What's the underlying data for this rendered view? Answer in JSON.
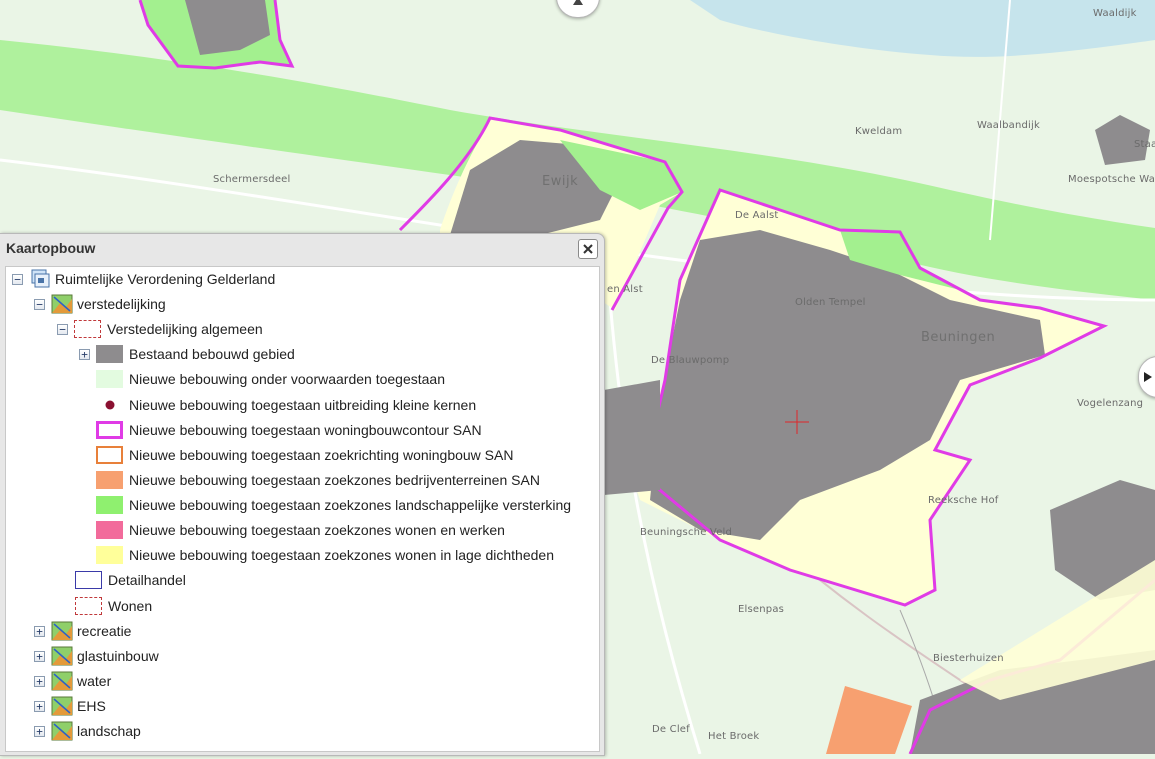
{
  "map": {
    "place_labels": [
      {
        "text": "Waaldijk"
      },
      {
        "text": "Kweldam"
      },
      {
        "text": "Waalbandijk"
      },
      {
        "text": "Schermersdeel"
      },
      {
        "text": "Ewijk"
      },
      {
        "text": "Moespotsche Waa"
      },
      {
        "text": "De Aalst"
      },
      {
        "text": "Olden Tempel"
      },
      {
        "text": "Beuningen"
      },
      {
        "text": "en Alst"
      },
      {
        "text": "De Blauwpomp"
      },
      {
        "text": "Vogelenzang"
      },
      {
        "text": "Reeksche Hof"
      },
      {
        "text": "Beuningsche Veld"
      },
      {
        "text": "Elsenpas"
      },
      {
        "text": "Biesterhuizen"
      },
      {
        "text": "De Clef"
      },
      {
        "text": "Het Broek"
      },
      {
        "text": "Staa"
      }
    ],
    "colors": {
      "background": "#eaf5e6",
      "river": "#c6e4ec",
      "zone_band": "#9ff08a",
      "built_area": "#8e8c8e",
      "contour": "#e03be6",
      "yellow_zone": "#ffffd6",
      "orange_zone": "#f7a070",
      "roads": "#ffffff"
    }
  },
  "panel": {
    "title": "Kaartopbouw",
    "close_icon": "close-icon",
    "tree": [
      {
        "label": "Ruimtelijke Verordening Gelderland",
        "toggle": "−",
        "icon": "service-icon"
      },
      {
        "label": "verstedelijking",
        "toggle": "−",
        "icon": "layer-group-icon"
      },
      {
        "label": "Verstedelijking algemeen",
        "toggle": "−",
        "symbol": "dashed-red-outline"
      },
      {
        "label": "Bestaand bebouwd gebied",
        "toggle": "+",
        "symbol": "grey-fill"
      },
      {
        "label": "Nieuwe bebouwing onder voorwaarden toegestaan",
        "symbol": "light-green-fill"
      },
      {
        "label": "Nieuwe bebouwing toegestaan uitbreiding kleine kernen",
        "symbol": "dark-red-dot"
      },
      {
        "label": "Nieuwe bebouwing toegestaan woningbouwcontour SAN",
        "symbol": "magenta-outline"
      },
      {
        "label": "Nieuwe bebouwing toegestaan zoekrichting woningbouw SAN",
        "symbol": "orange-outline"
      },
      {
        "label": "Nieuwe bebouwing toegestaan zoekzones bedrijventerreinen SAN",
        "symbol": "orange-fill"
      },
      {
        "label": "Nieuwe bebouwing toegestaan zoekzones landschappelijke versterking",
        "symbol": "green-fill"
      },
      {
        "label": "Nieuwe bebouwing toegestaan zoekzones wonen en werken",
        "symbol": "pink-fill"
      },
      {
        "label": "Nieuwe bebouwing toegestaan zoekzones wonen in lage dichtheden",
        "symbol": "yellow-fill"
      },
      {
        "label": "Detailhandel",
        "symbol": "blue-outline"
      },
      {
        "label": "Wonen",
        "symbol": "dashed-red-outline"
      },
      {
        "label": "recreatie",
        "toggle": "+",
        "icon": "layer-group-icon"
      },
      {
        "label": "glastuinbouw",
        "toggle": "+",
        "icon": "layer-group-icon"
      },
      {
        "label": "water",
        "toggle": "+",
        "icon": "layer-group-icon"
      },
      {
        "label": "EHS",
        "toggle": "+",
        "icon": "layer-group-icon"
      },
      {
        "label": "landschap",
        "toggle": "+",
        "icon": "layer-group-icon"
      }
    ]
  },
  "nav": {
    "pan_up_icon": "triangle-up-icon",
    "pan_right_icon": "triangle-right-icon"
  }
}
